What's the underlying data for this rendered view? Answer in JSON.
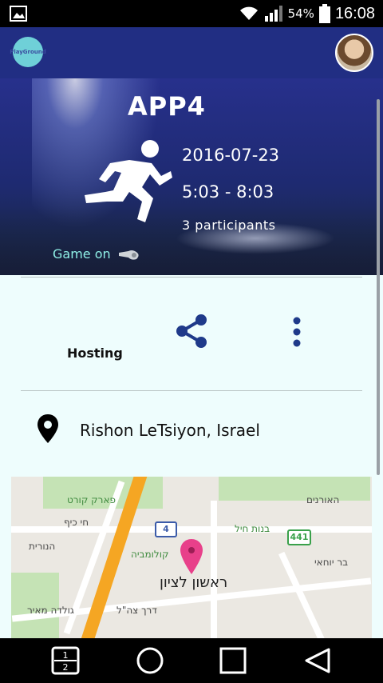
{
  "status_bar": {
    "battery_percent": "54%",
    "time": "16:08"
  },
  "app_bar": {
    "logo_text": "PlayGround"
  },
  "event": {
    "title": "APP4",
    "date": "2016-07-23",
    "time_range": "5:03  -  8:03",
    "participants": "3  participants",
    "status": "Game on"
  },
  "actions": {
    "hosting_label": "Hosting"
  },
  "location": {
    "name": "Rishon LeTsiyon, Israel"
  },
  "map": {
    "route_4": "4",
    "route_441": "441",
    "city_label": "ראשון לציון",
    "labels": [
      "פארק קורט",
      "חי כיף",
      "בנות חיל",
      "האורנים",
      "הנורית",
      "קולומביה",
      "בר יוחאי",
      "גולדה מאיר",
      "דרך צה\"ל"
    ]
  },
  "nav": {
    "recent_label": "1 2"
  }
}
